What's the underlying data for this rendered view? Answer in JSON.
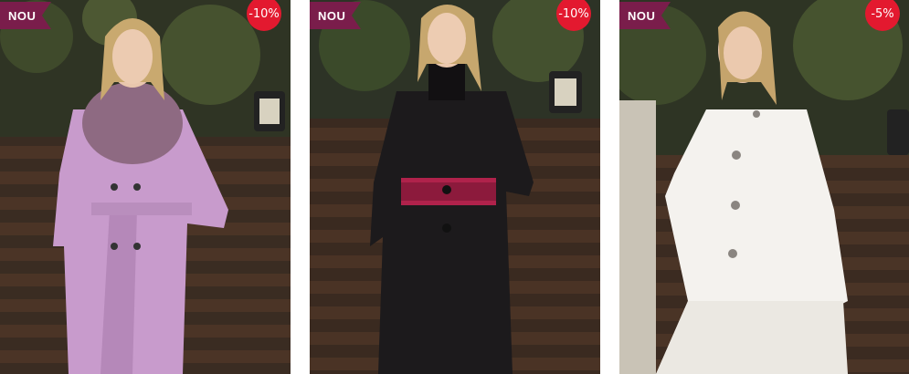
{
  "products": [
    {
      "badge_new": "NOU",
      "discount": "-10%",
      "image_alt": "lilac-coat-photo"
    },
    {
      "badge_new": "NOU",
      "discount": "-10%",
      "image_alt": "black-coat-photo"
    },
    {
      "badge_new": "NOU",
      "discount": "-5%",
      "image_alt": "white-coat-photo"
    }
  ],
  "colors": {
    "badge_new_bg": "#7a1d4b",
    "discount_bg": "#e3192f",
    "coat_lilac": "#c89bcc",
    "coat_black": "#1c1a1c",
    "coat_white": "#f4f2ee"
  }
}
